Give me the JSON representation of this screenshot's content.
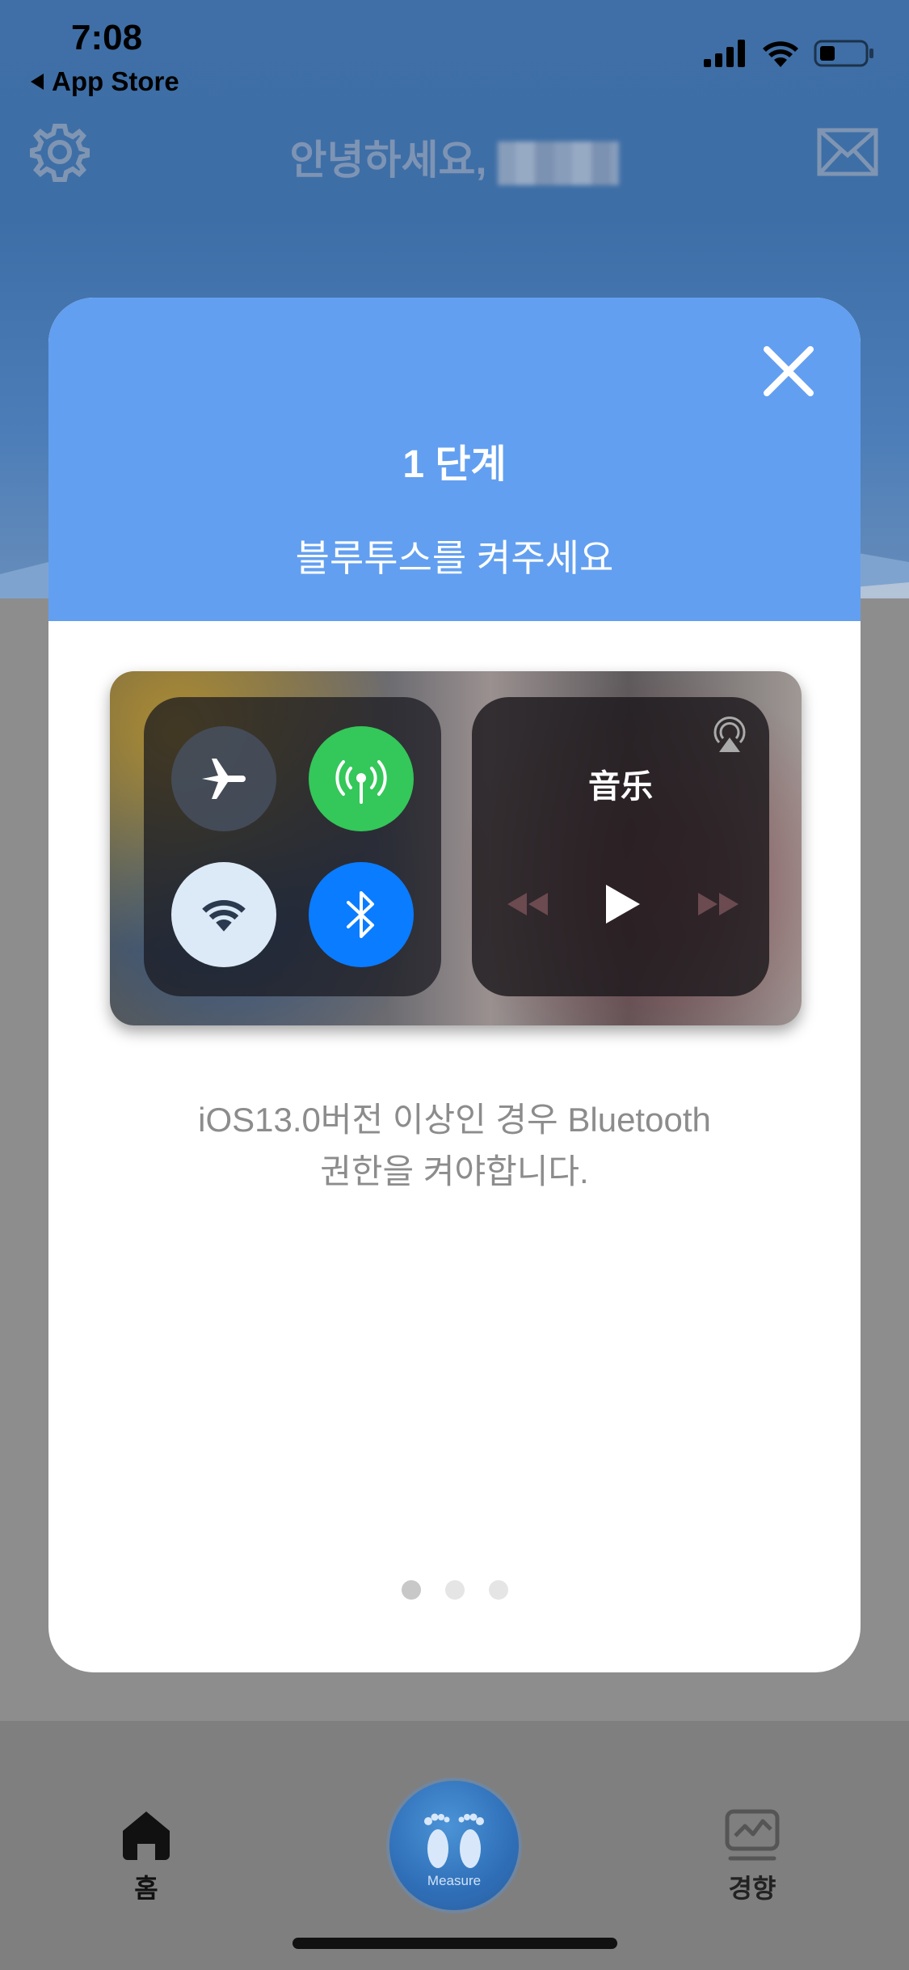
{
  "status_bar": {
    "time": "7:08",
    "back_app": "App Store",
    "icons": [
      "cellular-signal-icon",
      "wifi-icon",
      "battery-icon"
    ]
  },
  "header": {
    "greeting": "안녕하세요,",
    "left_icon": "gear-icon",
    "right_icon": "mail-icon"
  },
  "modal": {
    "step_title": "1 단계",
    "step_subtitle": "블루투스를 켜주세요",
    "close_icon": "close-icon",
    "illustration": {
      "toggles": [
        "airplane-icon",
        "cellular-data-icon",
        "wifi-icon",
        "bluetooth-icon"
      ],
      "music_title": "音乐",
      "music_controls": [
        "airplay-icon",
        "rewind-icon",
        "play-icon",
        "fast-forward-icon"
      ]
    },
    "description_line1": "iOS13.0버전 이상인 경우 Bluetooth",
    "description_line2": "권한을 켜야합니다.",
    "pagination": {
      "count": 3,
      "active": 1
    }
  },
  "tab_bar": {
    "home_label": "홈",
    "measure_label": "Measure",
    "trend_label": "경향"
  },
  "colors": {
    "modal_header": "#629ff0",
    "wifi_toggle": "#dce9f7",
    "cellular_toggle": "#34c759",
    "bluetooth_toggle": "#0a7cff",
    "description_text": "#8c8c8c"
  }
}
